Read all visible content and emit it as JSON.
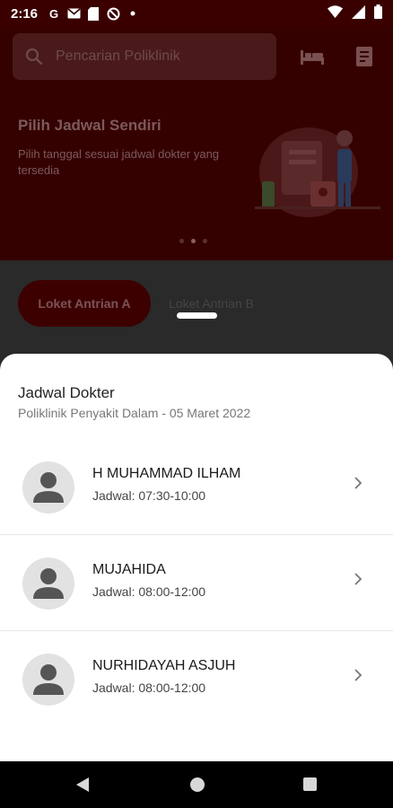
{
  "status_bar": {
    "time": "2:16",
    "left_icons": [
      "google-icon",
      "gmail-icon",
      "sim-card-icon",
      "blocked-icon",
      "dot-icon"
    ],
    "right_icons": [
      "wifi-icon",
      "signal-icon",
      "battery-icon"
    ]
  },
  "background_app": {
    "search_placeholder": "Pencarian Poliklinik",
    "hero_title": "Pilih Jadwal Sendiri",
    "hero_desc": "Pilih tanggal sesuai jadwal dokter yang tersedia",
    "tab_a": "Loket Antrian A",
    "tab_b": "Loket Antrian B",
    "carousel_dots": 3,
    "carousel_active_index": 1
  },
  "sheet": {
    "title": "Jadwal Dokter",
    "subtitle": "Poliklinik Penyakit Dalam - 05 Maret 2022",
    "doctors": [
      {
        "name": "H MUHAMMAD ILHAM",
        "schedule": "Jadwal: 07:30-10:00"
      },
      {
        "name": "MUJAHIDA",
        "schedule": "Jadwal: 08:00-12:00"
      },
      {
        "name": "NURHIDAYAH ASJUH",
        "schedule": "Jadwal: 08:00-12:00"
      }
    ]
  },
  "colors": {
    "brand_dark": "#350000",
    "sheet_bg": "#ffffff",
    "avatar_bg": "#e2e2e2",
    "avatar_fg": "#5a5a5a"
  }
}
